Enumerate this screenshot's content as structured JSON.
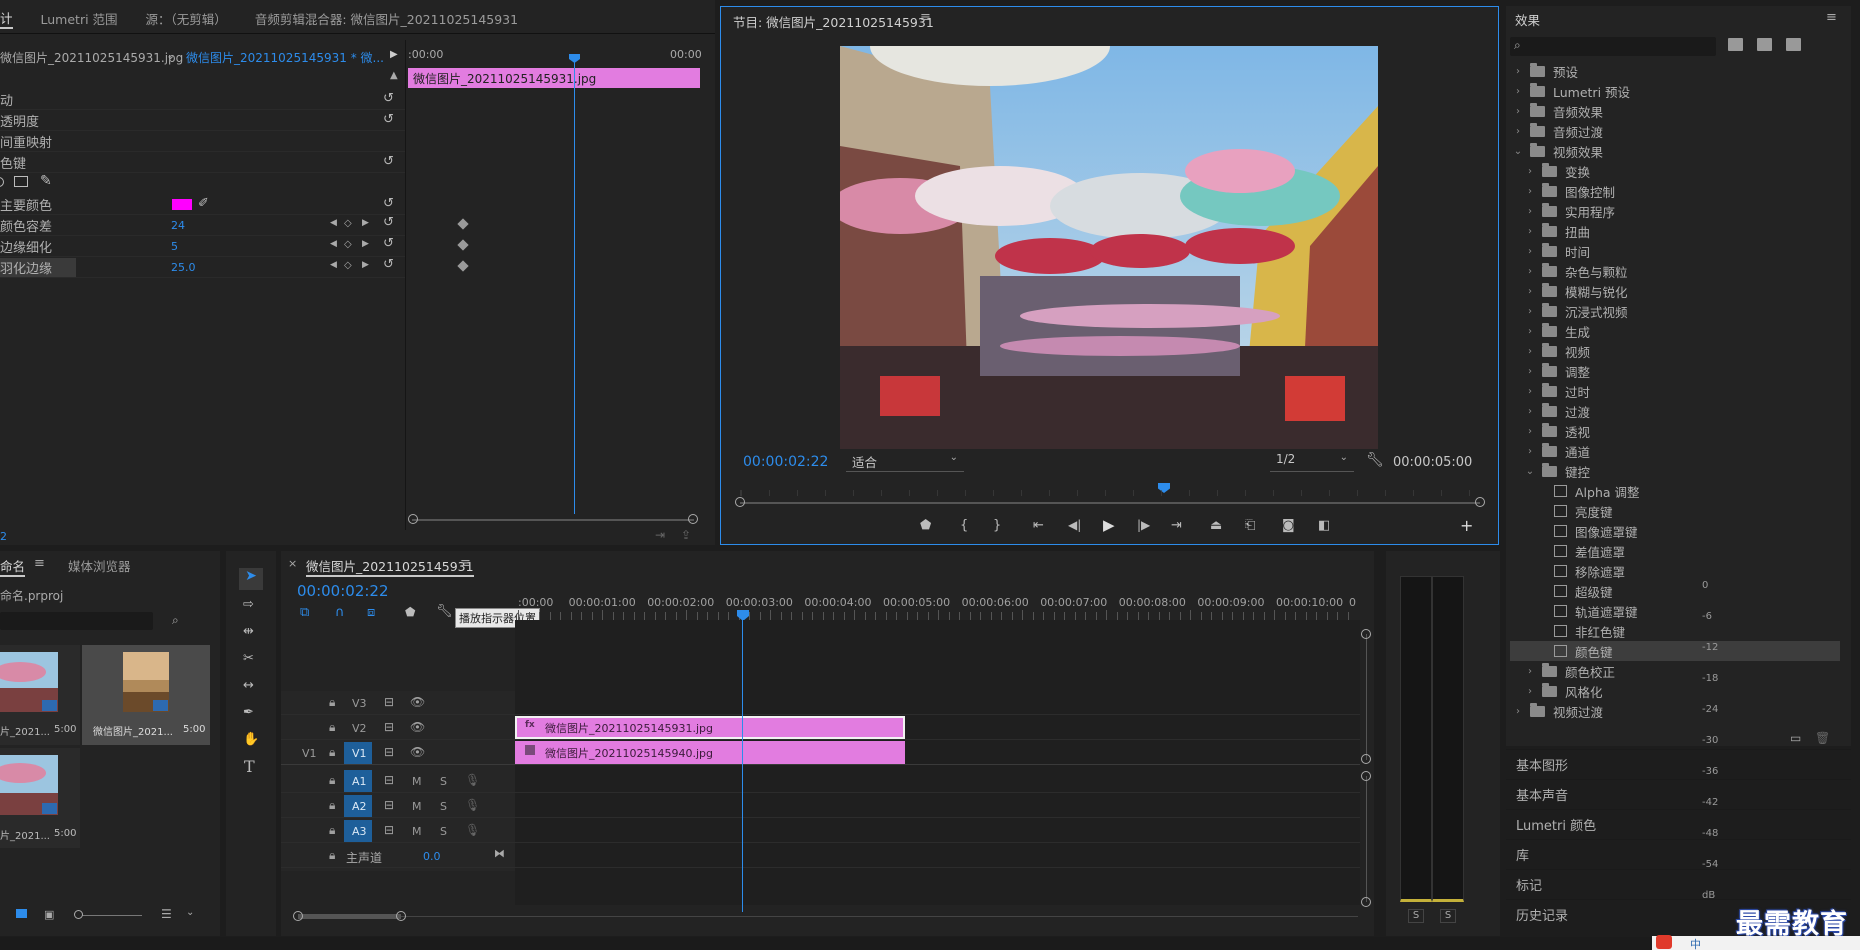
{
  "top_tabs": [
    "计",
    "Lumetri 范围",
    "源：（无剪辑）",
    "音频剪辑混合器: 微信图片_20211025145931"
  ],
  "effect_controls": {
    "source_clip": "微信图片_20211025145931.jpg",
    "sequence_clip": "微信图片_20211025145931 * 微...",
    "timecode_start": ":00:00",
    "timecode_end": "00:00",
    "clip_bar_label": "微信图片_20211025145931.jpg",
    "rows": [
      {
        "label": "动",
        "value": ""
      },
      {
        "label": "透明度",
        "value": ""
      },
      {
        "label": "间重映射",
        "value": ""
      },
      {
        "label": "色键",
        "value": ""
      },
      {
        "label": "主要颜色",
        "value": ""
      },
      {
        "label": "颜色容差",
        "value": "24"
      },
      {
        "label": "边缘细化",
        "value": "5"
      },
      {
        "label": "羽化边缘",
        "value": "25.0"
      }
    ],
    "key_color": "#ff00ff",
    "footer_timecode": "2"
  },
  "program": {
    "title": "节目: 微信图片_20211025145931",
    "timecode": "00:00:02:22",
    "fit": "适合",
    "resolution": "1/2",
    "duration": "00:00:05:00"
  },
  "effects": {
    "title": "效果",
    "search_placeholder": "",
    "tree": [
      {
        "label": "预设",
        "level": 0,
        "open": false,
        "kind": "folder"
      },
      {
        "label": "Lumetri 预设",
        "level": 0,
        "open": false,
        "kind": "folder"
      },
      {
        "label": "音频效果",
        "level": 0,
        "open": false,
        "kind": "folder"
      },
      {
        "label": "音频过渡",
        "level": 0,
        "open": false,
        "kind": "folder"
      },
      {
        "label": "视频效果",
        "level": 0,
        "open": true,
        "kind": "folder"
      },
      {
        "label": "变换",
        "level": 1,
        "open": false,
        "kind": "folder"
      },
      {
        "label": "图像控制",
        "level": 1,
        "open": false,
        "kind": "folder"
      },
      {
        "label": "实用程序",
        "level": 1,
        "open": false,
        "kind": "folder"
      },
      {
        "label": "扭曲",
        "level": 1,
        "open": false,
        "kind": "folder"
      },
      {
        "label": "时间",
        "level": 1,
        "open": false,
        "kind": "folder"
      },
      {
        "label": "杂色与颗粒",
        "level": 1,
        "open": false,
        "kind": "folder"
      },
      {
        "label": "模糊与锐化",
        "level": 1,
        "open": false,
        "kind": "folder"
      },
      {
        "label": "沉浸式视频",
        "level": 1,
        "open": false,
        "kind": "folder"
      },
      {
        "label": "生成",
        "level": 1,
        "open": false,
        "kind": "folder"
      },
      {
        "label": "视频",
        "level": 1,
        "open": false,
        "kind": "folder"
      },
      {
        "label": "调整",
        "level": 1,
        "open": false,
        "kind": "folder"
      },
      {
        "label": "过时",
        "level": 1,
        "open": false,
        "kind": "folder"
      },
      {
        "label": "过渡",
        "level": 1,
        "open": false,
        "kind": "folder"
      },
      {
        "label": "透视",
        "level": 1,
        "open": false,
        "kind": "folder"
      },
      {
        "label": "通道",
        "level": 1,
        "open": false,
        "kind": "folder"
      },
      {
        "label": "键控",
        "level": 1,
        "open": true,
        "kind": "folder"
      },
      {
        "label": "Alpha 调整",
        "level": 2,
        "open": false,
        "kind": "item"
      },
      {
        "label": "亮度键",
        "level": 2,
        "open": false,
        "kind": "item"
      },
      {
        "label": "图像遮罩键",
        "level": 2,
        "open": false,
        "kind": "item"
      },
      {
        "label": "差值遮罩",
        "level": 2,
        "open": false,
        "kind": "item"
      },
      {
        "label": "移除遮罩",
        "level": 2,
        "open": false,
        "kind": "item"
      },
      {
        "label": "超级键",
        "level": 2,
        "open": false,
        "kind": "item"
      },
      {
        "label": "轨道遮罩键",
        "level": 2,
        "open": false,
        "kind": "item"
      },
      {
        "label": "非红色键",
        "level": 2,
        "open": false,
        "kind": "item"
      },
      {
        "label": "颜色键",
        "level": 2,
        "open": false,
        "kind": "item",
        "selected": true
      },
      {
        "label": "颜色校正",
        "level": 1,
        "open": false,
        "kind": "folder"
      },
      {
        "label": "风格化",
        "level": 1,
        "open": false,
        "kind": "folder"
      },
      {
        "label": "视频过渡",
        "level": 0,
        "open": false,
        "kind": "folder"
      }
    ],
    "panels": [
      "基本图形",
      "基本声音",
      "Lumetri 颜色",
      "库",
      "标记",
      "历史记录"
    ]
  },
  "project": {
    "tabs": [
      "命名",
      "媒体浏览器"
    ],
    "file": "命名.prproj",
    "items": [
      {
        "name": "片_2021...",
        "duration": "5:00"
      },
      {
        "name": "微信图片_2021...",
        "duration": "5:00"
      },
      {
        "name": "片_2021...",
        "duration": "5:00"
      }
    ]
  },
  "timeline": {
    "title": "微信图片_20211025145931",
    "timecode": "00:00:02:22",
    "tooltip": "播放指示器位置",
    "ruler": [
      ":00:00",
      "00:00:01:00",
      "00:00:02:00",
      "00:00:03:00",
      "00:00:04:00",
      "00:00:05:00",
      "00:00:06:00",
      "00:00:07:00",
      "00:00:08:00",
      "00:00:09:00",
      "00:00:10:00",
      "0"
    ],
    "video_tracks": [
      "V3",
      "V2",
      "V1"
    ],
    "audio_tracks": [
      "A1",
      "A2",
      "A3"
    ],
    "source_patch": "V1",
    "master_label": "主声道",
    "master_value": "0.0",
    "clips": [
      {
        "track": "V2",
        "label": "微信图片_20211025145931.jpg"
      },
      {
        "track": "V1",
        "label": "微信图片_20211025145940.jpg"
      }
    ],
    "audio_buttons": {
      "m": "M",
      "s": "S"
    },
    "clip_color": "#e27ce0"
  },
  "meter": {
    "labels": [
      "0",
      "-6",
      "-12",
      "-18",
      "-24",
      "-30",
      "-36",
      "-42",
      "-48",
      "-54",
      "dB"
    ],
    "solo": [
      "S",
      "S"
    ]
  },
  "watermark": "最需教育",
  "taskbar_text": "中"
}
